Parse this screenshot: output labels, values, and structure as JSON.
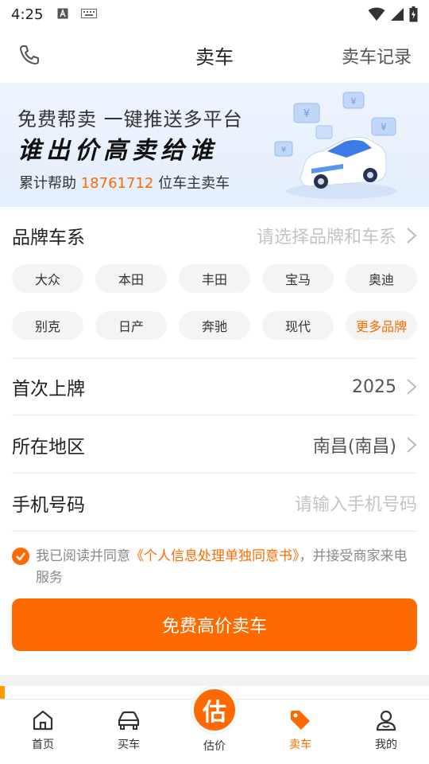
{
  "status_bar": {
    "time": "4:25"
  },
  "header": {
    "title": "卖车",
    "record_label": "卖车记录"
  },
  "banner": {
    "line1": "免费帮卖 一键推送多平台",
    "line2": "谁出价高卖给谁",
    "line3_prefix": "累计帮助 ",
    "count": "18761712",
    "line3_suffix": " 位车主卖车"
  },
  "form": {
    "brand": {
      "label": "品牌车系",
      "placeholder": "请选择品牌和车系"
    },
    "brands_row1": [
      "大众",
      "本田",
      "丰田",
      "宝马",
      "奥迪"
    ],
    "brands_row2": [
      "别克",
      "日产",
      "奔驰",
      "现代"
    ],
    "more_brands": "更多品牌",
    "first_reg": {
      "label": "首次上牌",
      "value": "2025"
    },
    "region": {
      "label": "所在地区",
      "value": "南昌(南昌)"
    },
    "phone": {
      "label": "手机号码",
      "placeholder": "请输入手机号码"
    },
    "agreement": {
      "prefix": "我已阅读并同意",
      "link": "《个人信息处理单独同意书》",
      "suffix": "，并接受商家来电服务"
    },
    "submit": "免费高价卖车"
  },
  "tabbar": {
    "home": "首页",
    "buy": "买车",
    "estimate": "估价",
    "estimate_badge": "估",
    "sell": "卖车",
    "mine": "我的"
  },
  "colors": {
    "accent": "#ff6a00"
  }
}
